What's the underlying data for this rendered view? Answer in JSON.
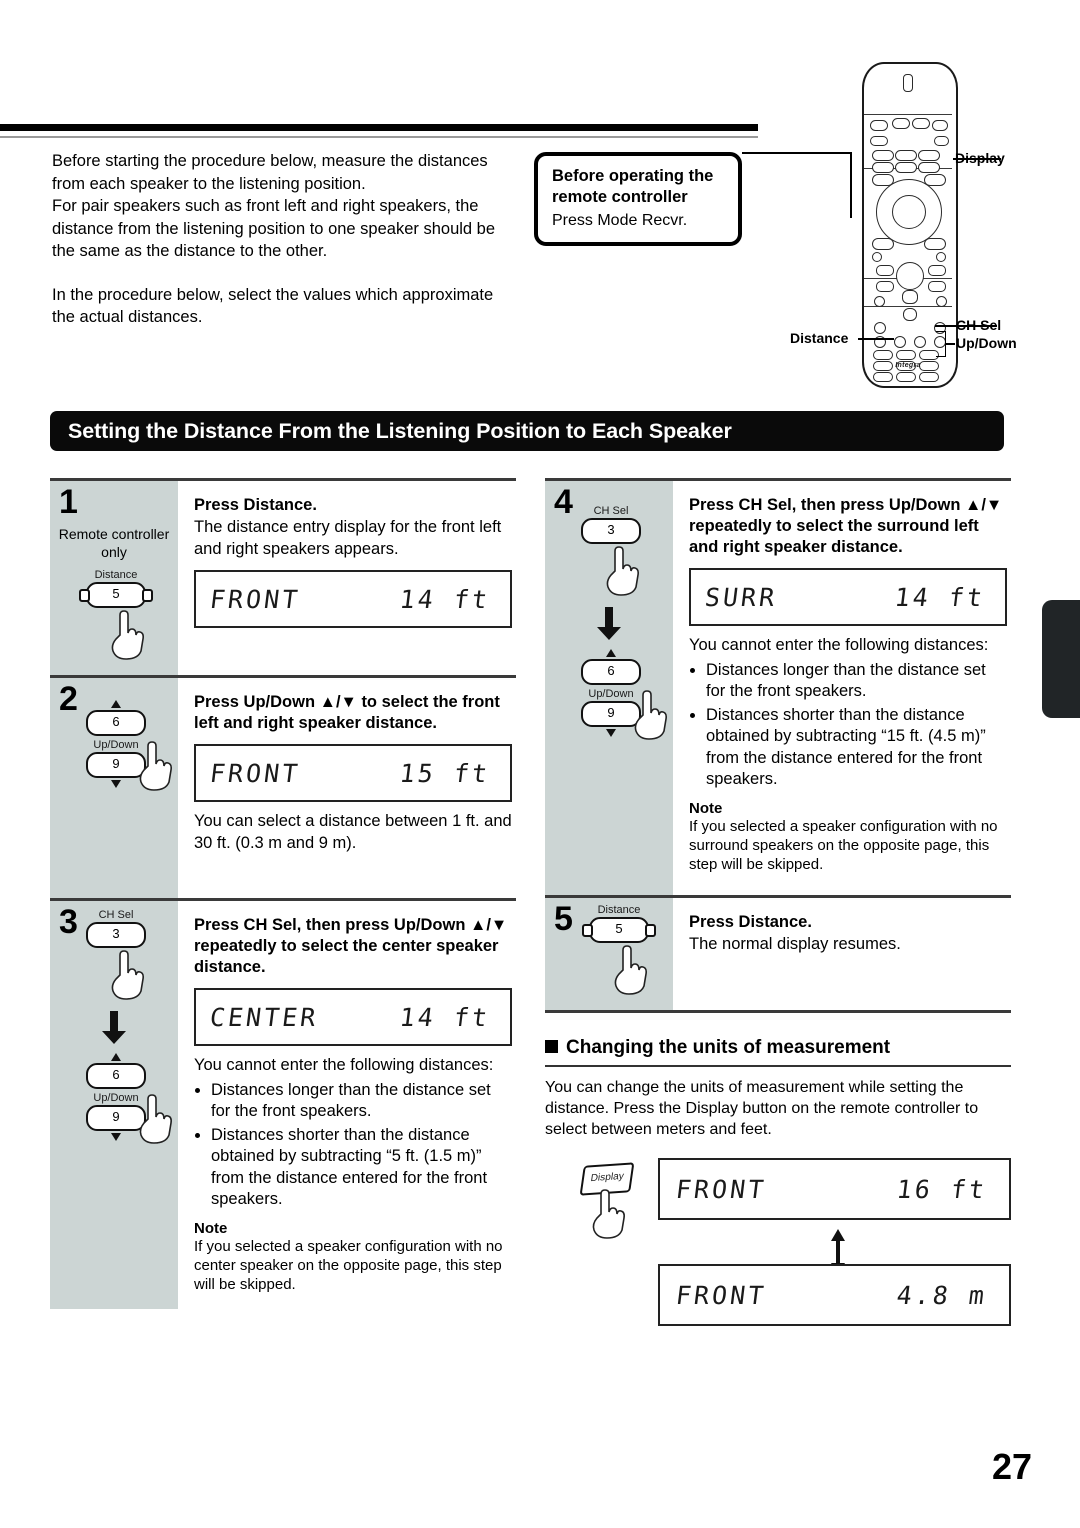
{
  "page_number": "27",
  "intro": {
    "paragraph1": "Before starting the procedure below, measure the distances from each speaker to the listening position.\nFor pair speakers such as front left and right speakers, the distance from the listening position to one speaker should be the same as the distance to the other.",
    "paragraph2": "In the procedure below, select the values which approximate the actual distances."
  },
  "callout": {
    "title": "Before operating the remote controller",
    "subtitle": "Press Mode Recvr."
  },
  "remote": {
    "brand": "Integra",
    "labels": {
      "display": "Display",
      "ch_sel": "CH Sel",
      "up_down": "Up/Down",
      "distance": "Distance"
    }
  },
  "section_header": "Setting the Distance From the Listening Position to Each Speaker",
  "steps": [
    {
      "number": "1",
      "side_note": "Remote controller\nonly",
      "key_label": "Distance",
      "key_value": "5",
      "title": "Press Distance.",
      "body": "The distance entry display for the front left and right speakers appears.",
      "display_left": "FRONT",
      "display_right": "14 ft"
    },
    {
      "number": "2",
      "key_label": "Up/Down",
      "key_up_value": "6",
      "key_down_value": "9",
      "title": "Press Up/Down ▲/▼ to select the front left and right speaker distance.",
      "display_left": "FRONT",
      "display_right": "15 ft",
      "body_after": "You can select a distance between 1 ft. and 30 ft. (0.3 m and 9 m)."
    },
    {
      "number": "3",
      "key_label": "CH Sel",
      "key_value": "3",
      "key_label2": "Up/Down",
      "key_up_value": "6",
      "key_down_value": "9",
      "title": "Press CH Sel, then press Up/Down ▲/▼ repeatedly to select the center speaker distance.",
      "display_left": "CENTER",
      "display_right": "14 ft",
      "restrict_intro": "You cannot enter the following distances:",
      "restrictions": [
        "Distances longer than the distance set for the front speakers.",
        "Distances shorter than the distance obtained by subtracting “5 ft. (1.5 m)” from the distance entered for the front speakers."
      ],
      "note_head": "Note",
      "note_body": "If you selected a speaker configuration with no center speaker on the opposite page, this step will be skipped."
    },
    {
      "number": "4",
      "key_label": "CH Sel",
      "key_value": "3",
      "key_label2": "Up/Down",
      "key_up_value": "6",
      "key_down_value": "9",
      "title": "Press CH Sel, then press Up/Down ▲/▼ repeatedly to select the surround left and right speaker distance.",
      "display_left": "SURR",
      "display_right": "14 ft",
      "restrict_intro": "You cannot enter the following distances:",
      "restrictions": [
        "Distances longer than the distance set for the front speakers.",
        "Distances shorter than the distance obtained by subtracting “15 ft. (4.5 m)” from the distance entered for the front speakers."
      ],
      "note_head": "Note",
      "note_body": "If you selected a speaker configuration with no surround speakers on the opposite page, this step will be skipped."
    },
    {
      "number": "5",
      "key_label": "Distance",
      "key_value": "5",
      "title": "Press Distance.",
      "body": "The normal display resumes."
    }
  ],
  "units_section": {
    "heading": "Changing the units of measurement",
    "body": "You can change the units of measurement while setting the distance. Press the Display button on the remote controller to select between meters and feet.",
    "button_label": "Display",
    "display_feet_left": "FRONT",
    "display_feet_right": "16 ft",
    "display_meters_left": "FRONT",
    "display_meters_right": "4.8 m"
  }
}
